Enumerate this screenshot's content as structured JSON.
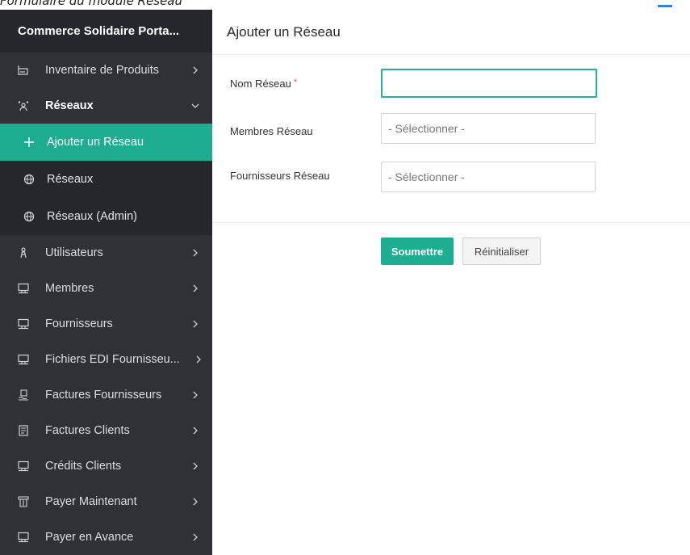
{
  "caption": "Formulaire du module Réseau",
  "brand": {
    "title": "Commerce Solidaire Porta..."
  },
  "sidebar": {
    "items": [
      {
        "label": "Inventaire de Produits",
        "icon": "inventory-icon"
      },
      {
        "label": "Réseaux",
        "icon": "network-users-icon",
        "expanded": true
      },
      {
        "label": "Utilisateurs",
        "icon": "user-icon"
      },
      {
        "label": "Membres",
        "icon": "monitor-icon"
      },
      {
        "label": "Fournisseurs",
        "icon": "monitor-icon"
      },
      {
        "label": "Fichiers EDI Fournisseu...",
        "icon": "monitor-icon"
      },
      {
        "label": "Factures Fournisseurs",
        "icon": "invoice-hand-icon"
      },
      {
        "label": "Factures Clients",
        "icon": "receipt-icon"
      },
      {
        "label": "Crédits Clients",
        "icon": "monitor-icon"
      },
      {
        "label": "Payer Maintenant",
        "icon": "pay-icon"
      },
      {
        "label": "Payer en Avance",
        "icon": "monitor-icon"
      }
    ],
    "submenu": [
      {
        "label": "Ajouter un Réseau",
        "icon": "plus-icon",
        "active": true
      },
      {
        "label": "Réseaux",
        "icon": "globe-icon"
      },
      {
        "label": "Réseaux (Admin)",
        "icon": "globe-icon"
      }
    ]
  },
  "main": {
    "title": "Ajouter un Réseau",
    "fields": {
      "name": {
        "label": "Nom Réseau",
        "required_mark": "*",
        "value": ""
      },
      "members": {
        "label": "Membres Réseau",
        "placeholder": "- Sélectionner -"
      },
      "suppliers": {
        "label": "Fournisseurs Réseau",
        "placeholder": "- Sélectionner -"
      }
    },
    "buttons": {
      "submit": "Soumettre",
      "reset": "Réinitialiser"
    }
  },
  "colors": {
    "accent": "#1fad91",
    "sidebar_bg": "#2f3137",
    "sidebar_dark": "#25272c",
    "required": "#e04b4b"
  }
}
